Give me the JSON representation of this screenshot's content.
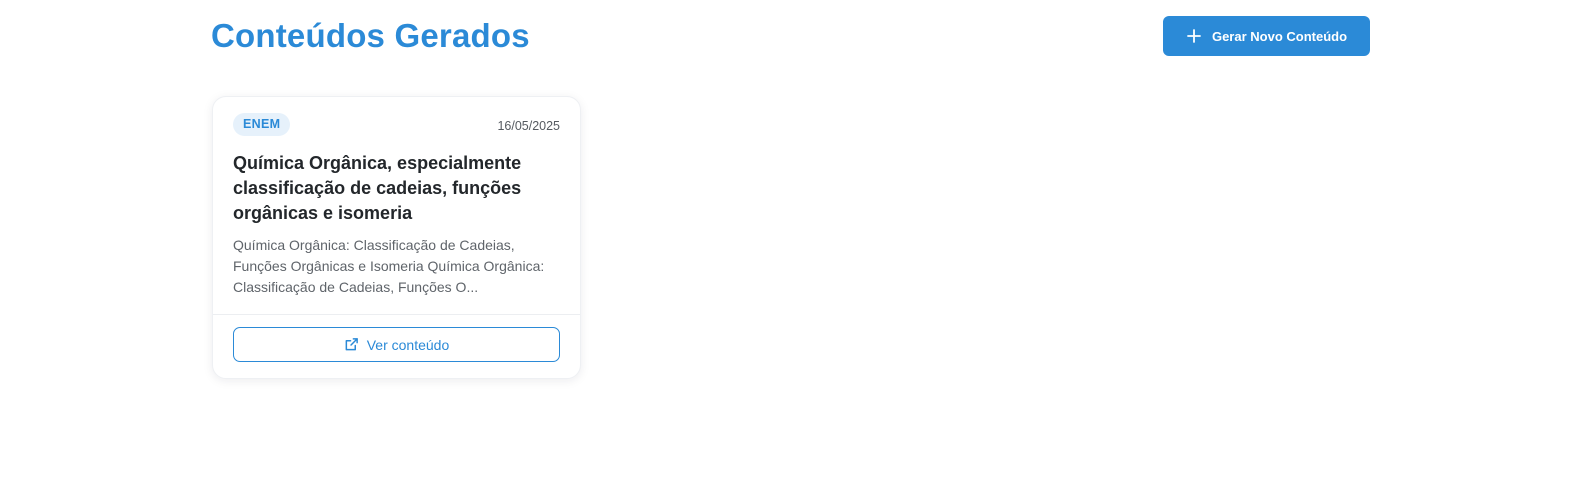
{
  "header": {
    "title": "Conteúdos Gerados",
    "new_button_label": "Gerar Novo Conteúdo",
    "new_button_icon": "plus-icon"
  },
  "cards": [
    {
      "tag": "ENEM",
      "date": "16/05/2025",
      "title": "Química Orgânica, especialmente classificação de cadeias, funções orgânicas e isomeria",
      "excerpt": "Química Orgânica: Classificação de Cadeias, Funções Orgânicas e Isomeria Química Orgânica: Classificação de Cadeias, Funções O...",
      "action_label": "Ver conteúdo",
      "action_icon": "external-link-icon"
    }
  ],
  "colors": {
    "accent": "#2b8ad7",
    "tag_background": "#e6f1fb",
    "title_text": "#23272b",
    "body_text": "#5f646a"
  }
}
